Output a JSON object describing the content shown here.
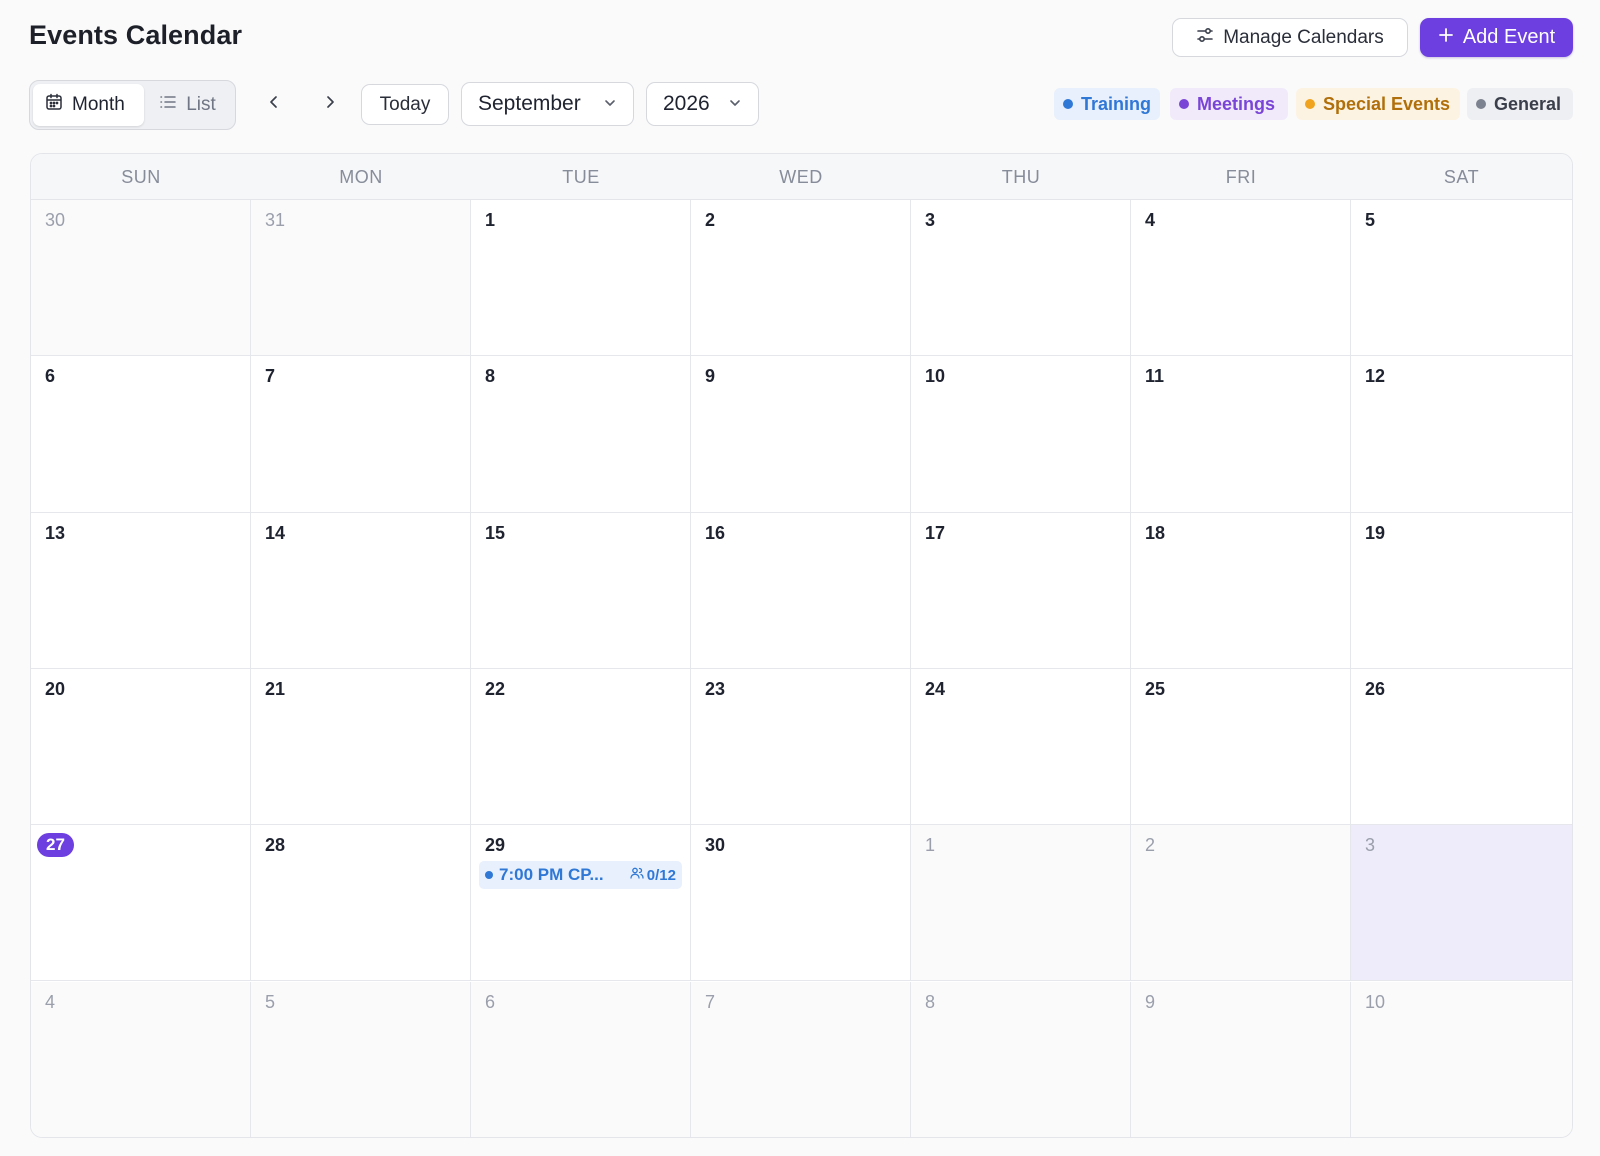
{
  "header": {
    "title": "Events Calendar",
    "manage_label": "Manage Calendars",
    "add_label": "Add Event"
  },
  "toolbar": {
    "views": [
      {
        "label": "Month",
        "icon": "calendar-icon",
        "active": true
      },
      {
        "label": "List",
        "icon": "list-icon",
        "active": false
      }
    ],
    "today_label": "Today",
    "month_value": "September",
    "year_value": "2026"
  },
  "legend": [
    {
      "label": "Training",
      "color": "#2f78d6",
      "bg": "#e7f0fc"
    },
    {
      "label": "Meetings",
      "color": "#7a45d6",
      "bg": "#f1eafb"
    },
    {
      "label": "Special Events",
      "color": "#b06f0a",
      "dot": "#f0a31e",
      "bg": "#fdf3e3"
    },
    {
      "label": "General",
      "color": "#3a3f4b",
      "dot": "#7d8290",
      "bg": "#eeeff2"
    }
  ],
  "calendar": {
    "weekdays": [
      "SUN",
      "MON",
      "TUE",
      "WED",
      "THU",
      "FRI",
      "SAT"
    ],
    "weeks": [
      [
        {
          "d": "30",
          "out": true
        },
        {
          "d": "31",
          "out": true
        },
        {
          "d": "1"
        },
        {
          "d": "2"
        },
        {
          "d": "3"
        },
        {
          "d": "4"
        },
        {
          "d": "5"
        }
      ],
      [
        {
          "d": "6"
        },
        {
          "d": "7"
        },
        {
          "d": "8"
        },
        {
          "d": "9"
        },
        {
          "d": "10"
        },
        {
          "d": "11"
        },
        {
          "d": "12"
        }
      ],
      [
        {
          "d": "13"
        },
        {
          "d": "14"
        },
        {
          "d": "15"
        },
        {
          "d": "16"
        },
        {
          "d": "17"
        },
        {
          "d": "18"
        },
        {
          "d": "19"
        }
      ],
      [
        {
          "d": "20"
        },
        {
          "d": "21"
        },
        {
          "d": "22"
        },
        {
          "d": "23"
        },
        {
          "d": "24"
        },
        {
          "d": "25"
        },
        {
          "d": "26"
        }
      ],
      [
        {
          "d": "27",
          "today": true
        },
        {
          "d": "28"
        },
        {
          "d": "29",
          "event": {
            "text": "7:00 PM CP...",
            "count": "0/12"
          }
        },
        {
          "d": "30"
        },
        {
          "d": "1",
          "out": true
        },
        {
          "d": "2",
          "out": true
        },
        {
          "d": "3",
          "out": true,
          "selected": true
        }
      ],
      [
        {
          "d": "4",
          "out": true
        },
        {
          "d": "5",
          "out": true
        },
        {
          "d": "6",
          "out": true
        },
        {
          "d": "7",
          "out": true
        },
        {
          "d": "8",
          "out": true
        },
        {
          "d": "9",
          "out": true
        },
        {
          "d": "10",
          "out": true
        }
      ]
    ]
  }
}
